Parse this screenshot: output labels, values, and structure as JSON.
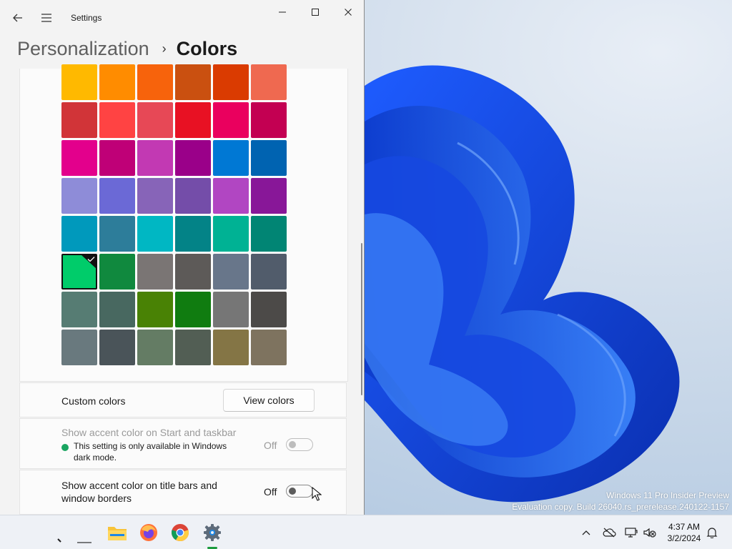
{
  "window": {
    "app_title": "Settings",
    "breadcrumb_parent": "Personalization",
    "breadcrumb_separator": "›",
    "breadcrumb_current": "Colors"
  },
  "swatches": [
    [
      "#ffb900",
      "#ff8c00",
      "#f7630c",
      "#ca5010",
      "#da3b01",
      "#ef6950"
    ],
    [
      "#d13438",
      "#ff4343",
      "#e74856",
      "#e81123",
      "#ea005e",
      "#c30052"
    ],
    [
      "#e3008c",
      "#bf0077",
      "#c239b3",
      "#9a0089",
      "#0078d4",
      "#0063b1"
    ],
    [
      "#8e8cd8",
      "#6b69d6",
      "#8764b8",
      "#744da9",
      "#b146c2",
      "#881798"
    ],
    [
      "#0099bc",
      "#2d7d9a",
      "#00b7c3",
      "#038387",
      "#00b294",
      "#018574"
    ],
    [
      "#00cc6a",
      "#10893e",
      "#7a7574",
      "#5d5a58",
      "#68768a",
      "#515c6b"
    ],
    [
      "#567c73",
      "#486860",
      "#498205",
      "#107c10",
      "#767676",
      "#4c4a48"
    ],
    [
      "#69797e",
      "#4a5459",
      "#647c64",
      "#525e54",
      "#847545",
      "#7e735f"
    ]
  ],
  "selected_swatch": "#00cc6a",
  "custom_colors": {
    "label": "Custom colors",
    "button": "View colors"
  },
  "accent_start": {
    "label": "Show accent color on Start and taskbar",
    "note": "This setting is only available in Windows dark mode.",
    "state": "Off",
    "enabled": false
  },
  "accent_titlebar": {
    "label": "Show accent color on title bars and window borders",
    "state": "Off",
    "enabled": true
  },
  "watermark": {
    "line1": "Windows 11 Pro Insider Preview",
    "line2": "Evaluation copy. Build 26040.rs_prerelease.240122-1157"
  },
  "taskbar": {
    "apps": [
      "file-explorer",
      "firefox",
      "chrome",
      "settings"
    ],
    "active_app": "settings",
    "time": "4:37 AM",
    "date": "3/2/2024"
  }
}
